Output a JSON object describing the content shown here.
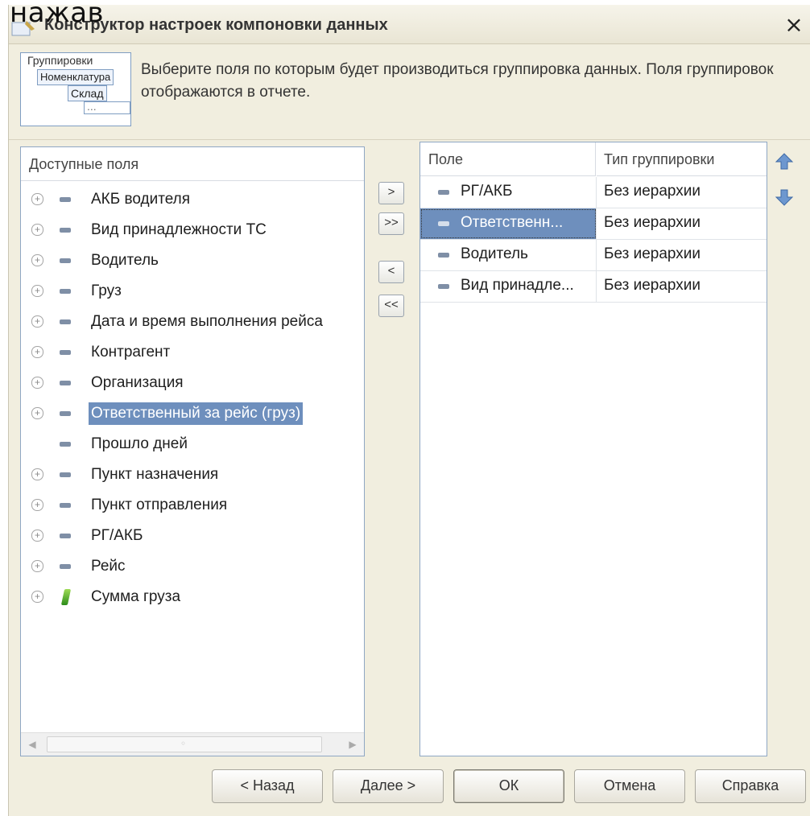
{
  "overlay_caption": "нажав",
  "window": {
    "title": "Конструктор настроек компоновки данных",
    "close_label": "×"
  },
  "intro": {
    "illustration": {
      "title": "Группировки",
      "item1": "Номенклатура",
      "item2": "Склад",
      "item3": "..."
    },
    "text": "Выберите поля по которым будет производиться группировка данных. Поля группировок отображаются в отчете."
  },
  "available_fields": {
    "header": "Доступные поля",
    "items": [
      {
        "label": "АКБ водителя",
        "expandable": true,
        "icon": "field-dash-icon"
      },
      {
        "label": "Вид принадлежности ТС",
        "expandable": true,
        "icon": "field-dash-icon"
      },
      {
        "label": "Водитель",
        "expandable": true,
        "icon": "field-dash-icon"
      },
      {
        "label": "Груз",
        "expandable": true,
        "icon": "field-dash-icon"
      },
      {
        "label": "Дата и время выполнения рейса",
        "expandable": true,
        "icon": "field-dash-icon"
      },
      {
        "label": "Контрагент",
        "expandable": true,
        "icon": "field-dash-icon"
      },
      {
        "label": "Организация",
        "expandable": true,
        "icon": "field-dash-icon"
      },
      {
        "label": "Ответственный за рейс (груз)",
        "expandable": true,
        "icon": "field-dash-icon",
        "selected": true
      },
      {
        "label": "Прошло дней",
        "expandable": false,
        "icon": "field-dash-icon"
      },
      {
        "label": "Пункт назначения",
        "expandable": true,
        "icon": "field-dash-icon"
      },
      {
        "label": "Пункт отправления",
        "expandable": true,
        "icon": "field-dash-icon"
      },
      {
        "label": "РГ/АКБ",
        "expandable": true,
        "icon": "field-dash-icon"
      },
      {
        "label": "Рейс",
        "expandable": true,
        "icon": "field-dash-icon"
      },
      {
        "label": "Сумма груза",
        "expandable": true,
        "icon": "numeric-resource-icon"
      }
    ]
  },
  "move_buttons": {
    "add": ">",
    "add_all": ">>",
    "remove": "<",
    "remove_all": "<<"
  },
  "grouping_grid": {
    "col_field": "Поле",
    "col_type": "Тип группировки",
    "rows": [
      {
        "field": "РГ/АКБ",
        "type": "Без иерархии"
      },
      {
        "field": "Ответственн...",
        "type": "Без иерархии",
        "current": true
      },
      {
        "field": "Водитель",
        "type": "Без иерархии"
      },
      {
        "field": "Вид принадле...",
        "type": "Без иерархии"
      }
    ]
  },
  "footer": {
    "back": "< Назад",
    "next": "Далее >",
    "ok": "ОК",
    "cancel": "Отмена",
    "help": "Справка"
  },
  "colors": {
    "selection": "#6e8fbd",
    "dialog_bg": "#f1eedf",
    "panel_border": "#8fa7c4"
  }
}
